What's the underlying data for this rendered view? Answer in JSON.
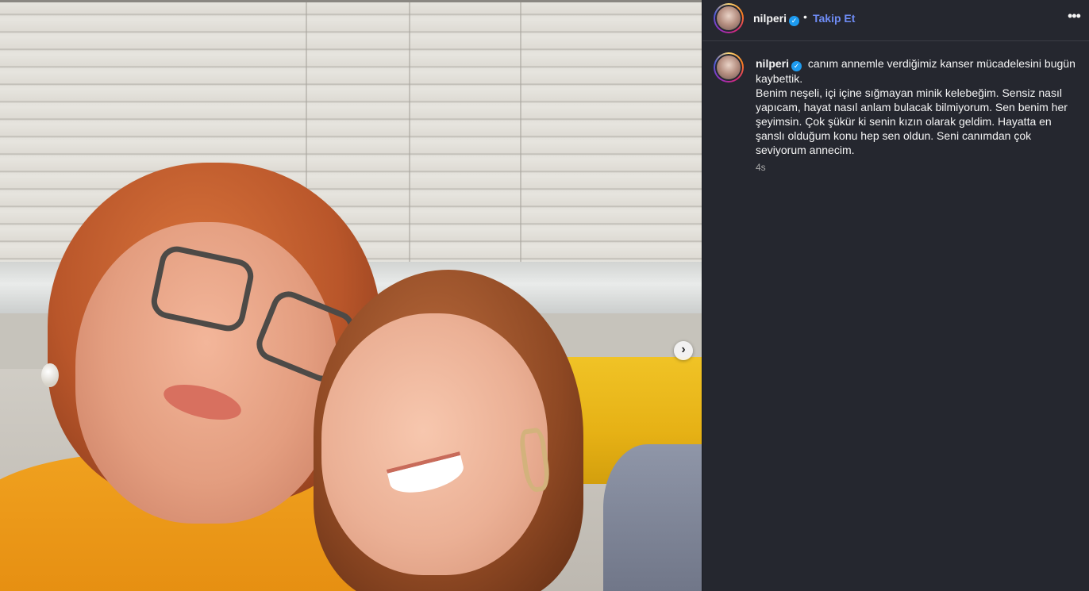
{
  "post": {
    "media": {
      "next_icon": "chevron-right-icon",
      "next_glyph": "›"
    },
    "header": {
      "username": "nilperi",
      "separator": "•",
      "follow_label": "Takip Et",
      "more_glyph": "•••",
      "verified_glyph": "✓"
    },
    "caption": {
      "username": "nilperi",
      "lines": [
        "canım annemle verdiğimiz kanser mücadelesini bugün kaybettik.",
        "Benim neşeli, içi içine sığmayan minik kelebeğim. Sensiz nasıl yapıcam, hayat nasıl anlam bulacak bilmiyorum. Sen benim her şeyimsin. Çok şükür ki senin kızın olarak geldim. Hayatta en şanslı olduğum konu hep sen oldun. Seni canımdan çok seviyorum annecim."
      ],
      "timestamp": "4s"
    }
  },
  "colors": {
    "background": "#25272f",
    "follow_link": "#6f8cf5",
    "verified": "#1d9bf0",
    "muted_text": "#a8a8a8"
  }
}
